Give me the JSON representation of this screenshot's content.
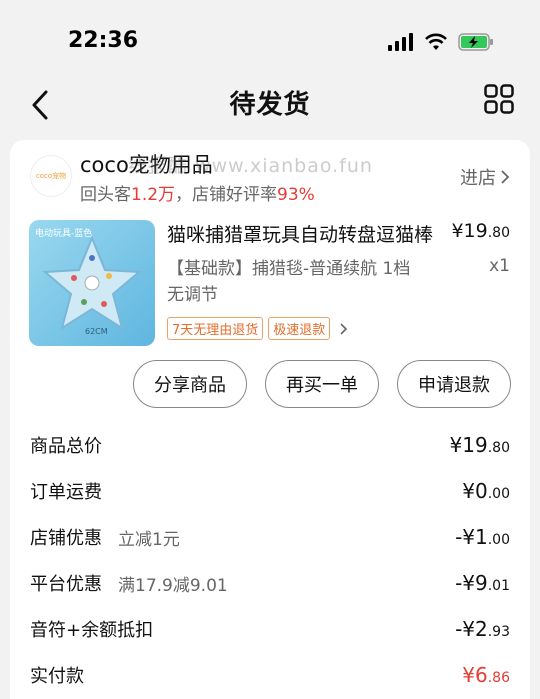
{
  "status_bar": {
    "time": "22:36"
  },
  "nav": {
    "title": "待发货"
  },
  "shop": {
    "logo_text": "coco宠物",
    "name": "coco宠物用品",
    "repeat_label": "回头客",
    "repeat_value": "1.2万",
    "rating_label": "，店铺好评率",
    "rating_value": "93%",
    "enter_label": "进店",
    "watermark": "线报酷 www.xianbao.fun"
  },
  "product": {
    "thumb_tag": "电动玩具-蓝色",
    "thumb_size": "62CM",
    "title": "猫咪捕猎罩玩具自动转盘逗猫棒",
    "price_main": "¥19",
    "price_cents": ".80",
    "spec": "【基础款】捕猎毯-普通续航 1档无调节",
    "qty": "x1",
    "tags": [
      "7天无理由退货",
      "极速退款"
    ]
  },
  "actions": {
    "share": "分享商品",
    "rebuy": "再买一单",
    "refund": "申请退款"
  },
  "summary": [
    {
      "label": "商品总价",
      "sub": "",
      "main": "¥19",
      "cents": ".80"
    },
    {
      "label": "订单运费",
      "sub": "",
      "main": "¥0",
      "cents": ".00"
    },
    {
      "label": "店铺优惠",
      "sub": "立减1元",
      "main": "-¥1",
      "cents": ".00"
    },
    {
      "label": "平台优惠",
      "sub": "满17.9减9.01",
      "main": "-¥9",
      "cents": ".01"
    },
    {
      "label": "音符+余额抵扣",
      "sub": "",
      "main": "-¥2",
      "cents": ".93"
    },
    {
      "label": "实付款",
      "sub": "",
      "main": "¥6",
      "cents": ".86"
    }
  ],
  "colors": {
    "accent_red": "#e53b35",
    "tag_orange": "#e66d2a"
  }
}
